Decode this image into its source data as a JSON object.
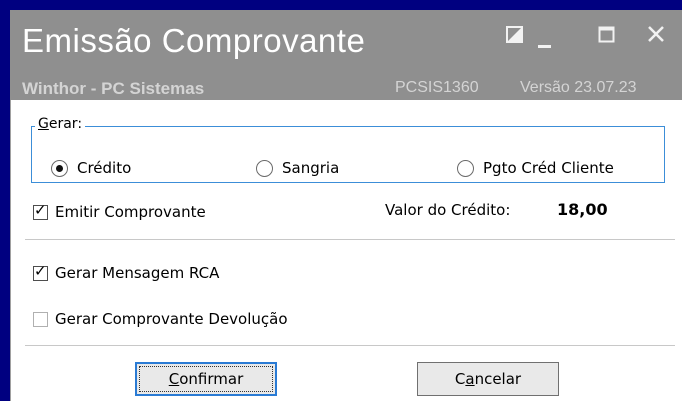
{
  "window": {
    "title": "Emissão Comprovante",
    "subtitle": "Winthor - PC Sistemas",
    "program_code": "PCSIS1360",
    "version": "Versão 23.07.23",
    "controls": [
      "restore-icon",
      "minimize-icon",
      "maximize-icon",
      "close-icon"
    ]
  },
  "gerar": {
    "legend_first": "G",
    "legend_rest": "erar:",
    "options": [
      {
        "label": "Crédito",
        "selected": true
      },
      {
        "label": "Sangria",
        "selected": false
      },
      {
        "label": "Pgto Créd Cliente",
        "selected": false
      }
    ]
  },
  "emitir_comprovante": {
    "label": "Emitir Comprovante",
    "checked": true
  },
  "valor_credito": {
    "label": "Valor do Crédito:",
    "value": "18,00"
  },
  "gerar_mensagem_rca": {
    "label": "Gerar Mensagem RCA",
    "checked": true
  },
  "gerar_comprovante_devolucao": {
    "label": "Gerar Comprovante Devolução",
    "checked": false
  },
  "buttons": {
    "confirm_mnemonic": "C",
    "confirm_rest": "onfirmar",
    "cancel_pre": "C",
    "cancel_mnemonic": "a",
    "cancel_rest": "ncelar"
  },
  "colors": {
    "frame": "#000080",
    "titlebar": "#8f8f8f",
    "group_border": "#3c8ed8",
    "focus_border": "#2a7bd4"
  }
}
